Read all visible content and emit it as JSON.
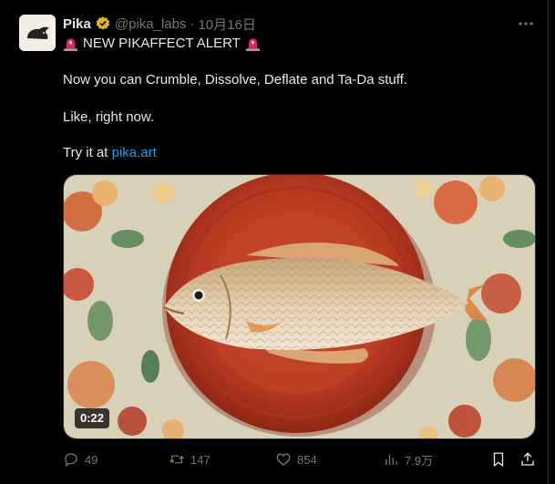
{
  "tweet": {
    "author_name": "Pika",
    "handle": "@pika_labs",
    "separator": "·",
    "date": "10月16日",
    "alert_text": "NEW PIKAFFECT ALERT",
    "line1": "Now you can Crumble, Dissolve, Deflate and Ta-Da stuff.",
    "line2": "Like, right now.",
    "line3_prefix": "Try it at ",
    "link_text": "pika.art"
  },
  "media": {
    "duration": "0:22"
  },
  "actions": {
    "replies": "49",
    "reposts": "147",
    "likes": "854",
    "views": "7.9万"
  },
  "colors": {
    "accent": "#1d9bf0",
    "verified": "#e2b719",
    "muted": "#71767b"
  }
}
